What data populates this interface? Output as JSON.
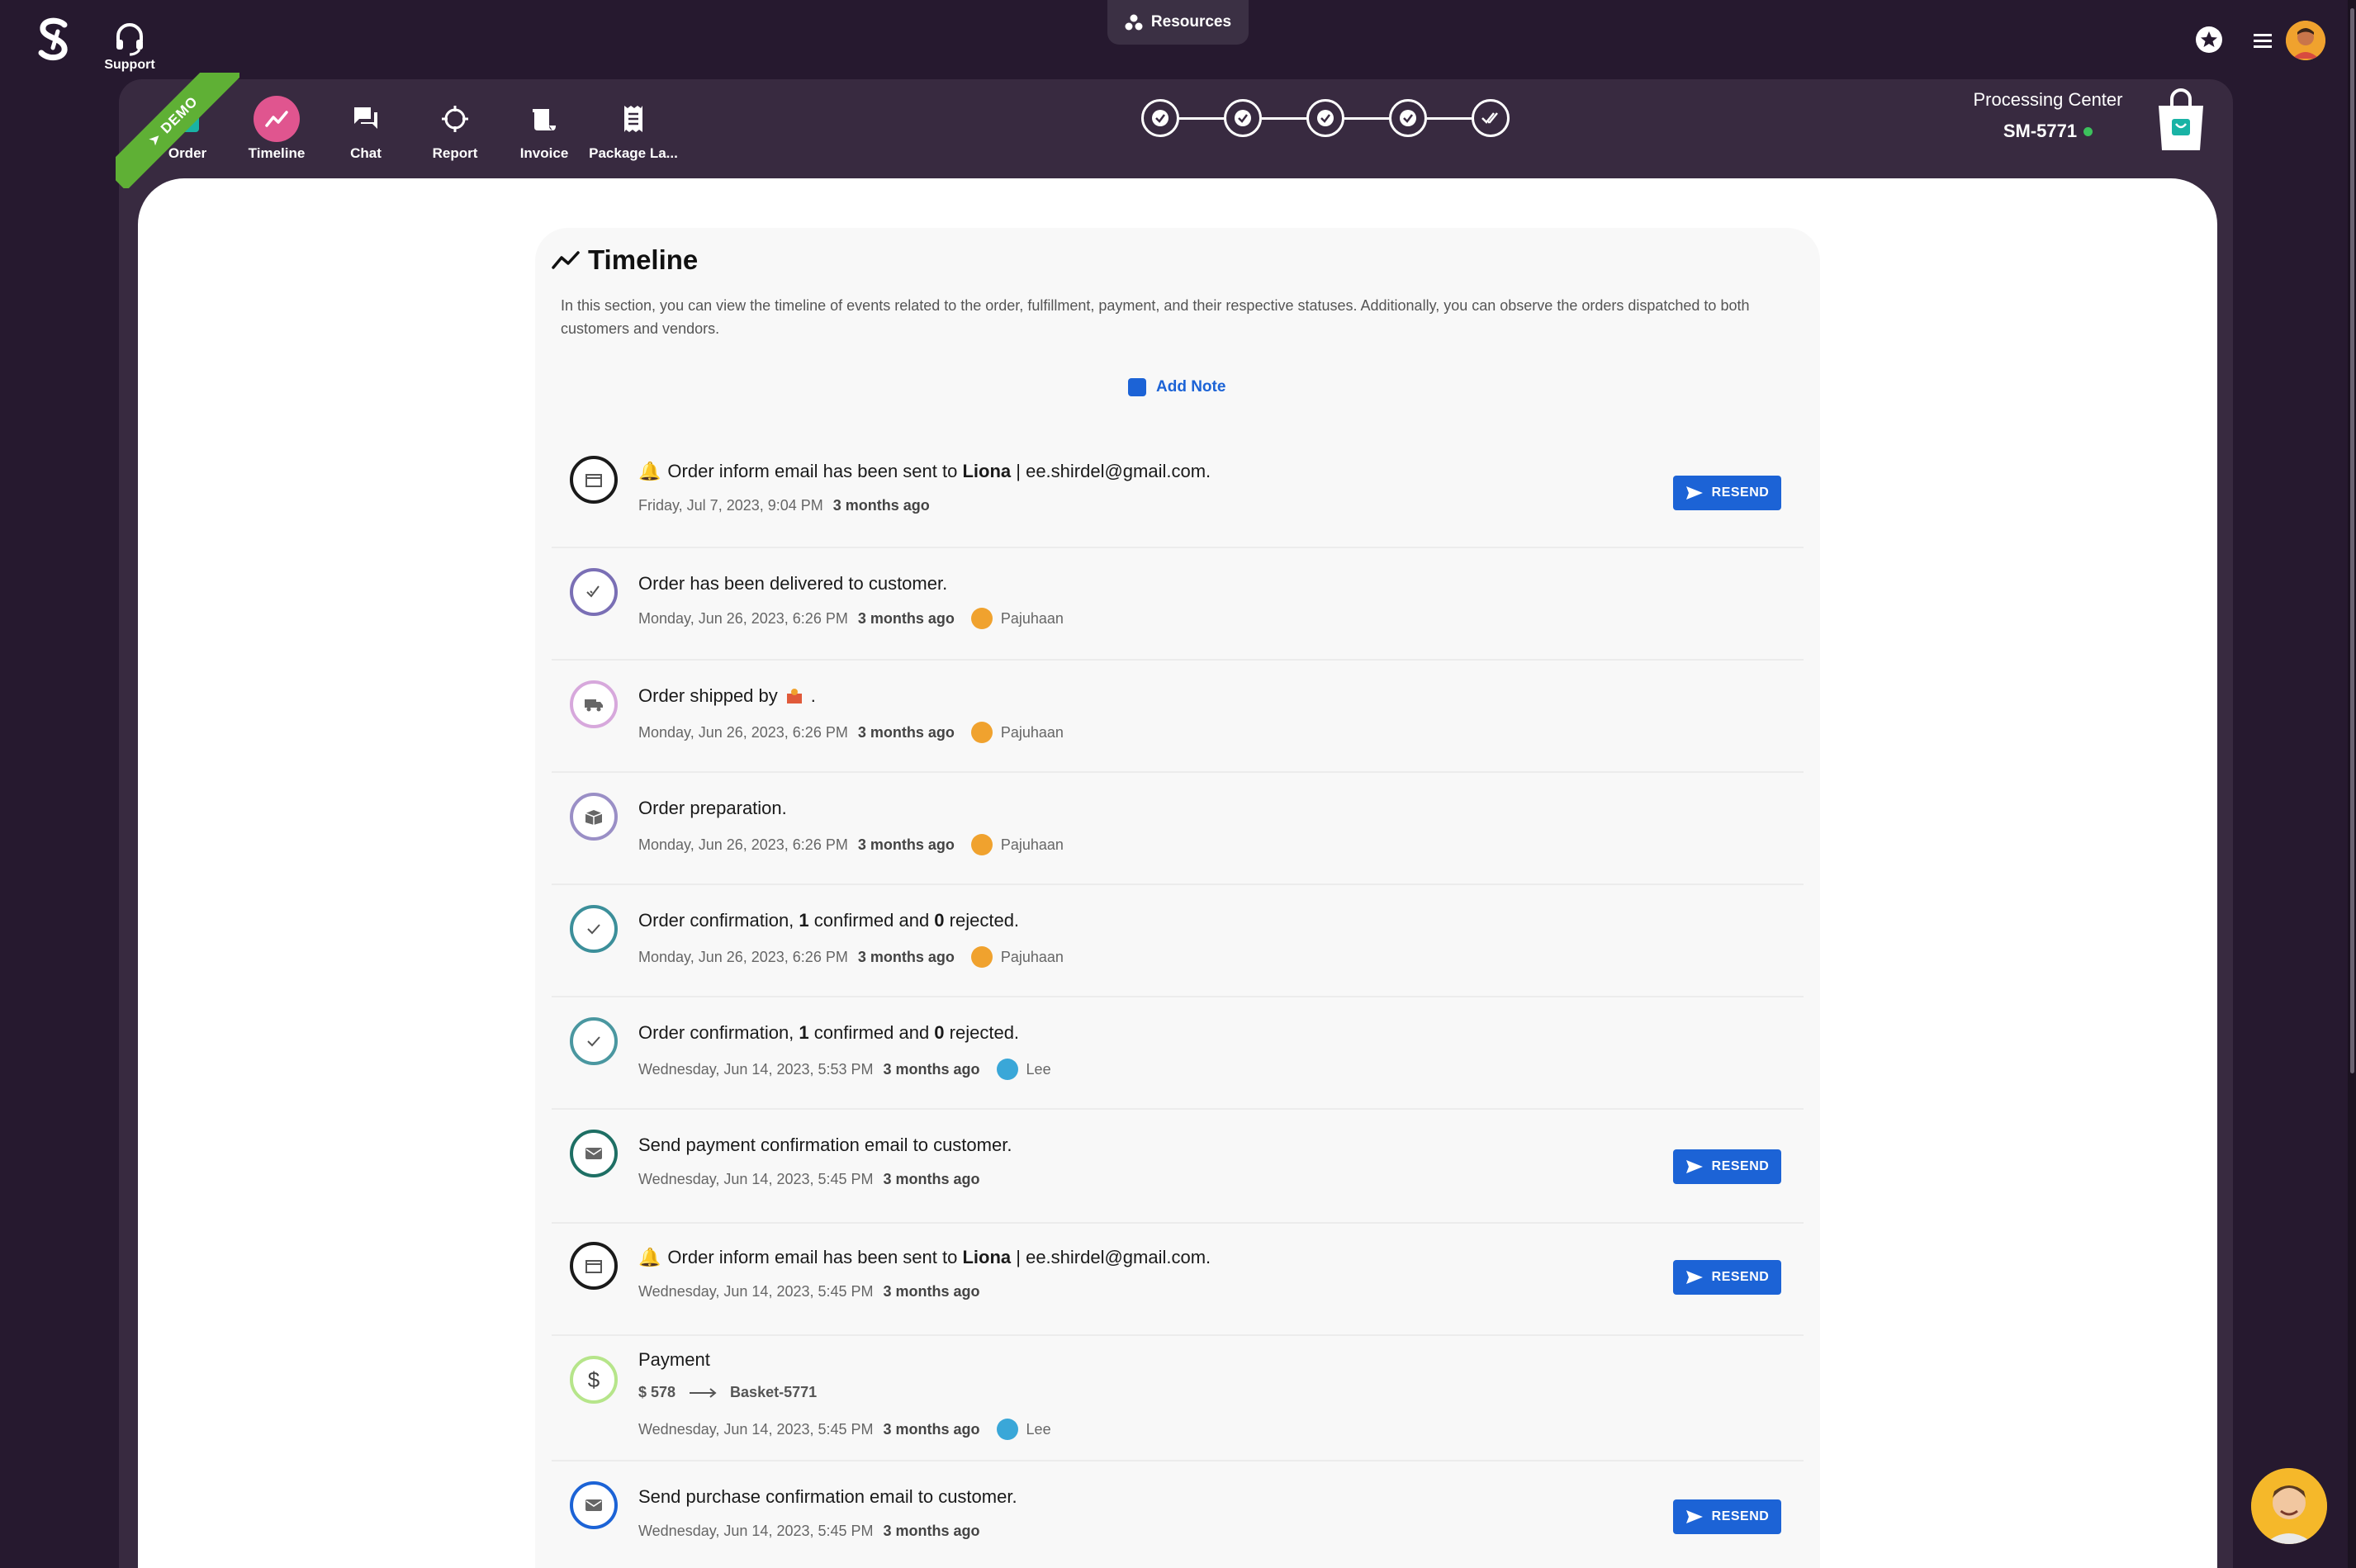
{
  "topbar": {
    "support_label": "Support",
    "resources_label": "Resources"
  },
  "nav": {
    "demo_label": "DEMO",
    "items": [
      {
        "label": "Order",
        "icon": "bag-icon"
      },
      {
        "label": "Timeline",
        "icon": "timeline-icon"
      },
      {
        "label": "Chat",
        "icon": "chat-icon"
      },
      {
        "label": "Report",
        "icon": "crosshair-icon"
      },
      {
        "label": "Invoice",
        "icon": "invoice-icon"
      },
      {
        "label": "Package La...",
        "icon": "receipt-icon"
      }
    ],
    "steps_total": 5
  },
  "processing": {
    "title": "Processing Center",
    "id": "SM-5771"
  },
  "timeline": {
    "title": "Timeline",
    "description": "In this section, you can view the timeline of events related to the order, fulfillment, payment, and their respective statuses. Additionally, you can observe the orders dispatched to both customers and vendors.",
    "add_note": "Add Note",
    "resend_label": "RESEND",
    "events": [
      {
        "pre": "Order inform email has been sent to ",
        "bold": "Liona",
        "post": " | ee.shirdel@gmail.com.",
        "date": "Friday, Jul 7, 2023, 9:04 PM",
        "ago": "3 months ago",
        "user": ""
      },
      {
        "pre": "Order has been delivered to customer.",
        "date": "Monday, Jun 26, 2023, 6:26 PM",
        "ago": "3 months ago",
        "user": "Pajuhaan"
      },
      {
        "pre": "Order shipped by ",
        "post": ".",
        "date": "Monday, Jun 26, 2023, 6:26 PM",
        "ago": "3 months ago",
        "user": "Pajuhaan"
      },
      {
        "pre": "Order preparation.",
        "date": "Monday, Jun 26, 2023, 6:26 PM",
        "ago": "3 months ago",
        "user": "Pajuhaan"
      },
      {
        "pre": "Order confirmation, ",
        "n1": "1",
        "mid": " confirmed and ",
        "n2": "0",
        "post": " rejected.",
        "date": "Monday, Jun 26, 2023, 6:26 PM",
        "ago": "3 months ago",
        "user": "Pajuhaan"
      },
      {
        "pre": "Order confirmation, ",
        "n1": "1",
        "mid": " confirmed and ",
        "n2": "0",
        "post": " rejected.",
        "date": "Wednesday, Jun 14, 2023, 5:53 PM",
        "ago": "3 months ago",
        "user": "Lee"
      },
      {
        "pre": "Send payment confirmation email to customer.",
        "date": "Wednesday, Jun 14, 2023, 5:45 PM",
        "ago": "3 months ago",
        "user": ""
      },
      {
        "pre": "Order inform email has been sent to ",
        "bold": "Liona",
        "post": " | ee.shirdel@gmail.com.",
        "date": "Wednesday, Jun 14, 2023, 5:45 PM",
        "ago": "3 months ago",
        "user": ""
      },
      {
        "pre": "Payment",
        "amount": "$ 578",
        "target": "Basket-5771",
        "date": "Wednesday, Jun 14, 2023, 5:45 PM",
        "ago": "3 months ago",
        "user": "Lee"
      },
      {
        "pre": "Send purchase confirmation email to customer.",
        "date": "Wednesday, Jun 14, 2023, 5:45 PM",
        "ago": "3 months ago",
        "user": ""
      }
    ]
  },
  "colors": {
    "background": "#26192f",
    "panel": "#382a40",
    "accent_pink": "#e0558f",
    "primary_blue": "#1c63d6",
    "demo_green": "#5fb035",
    "online_green": "#3cc15c"
  }
}
